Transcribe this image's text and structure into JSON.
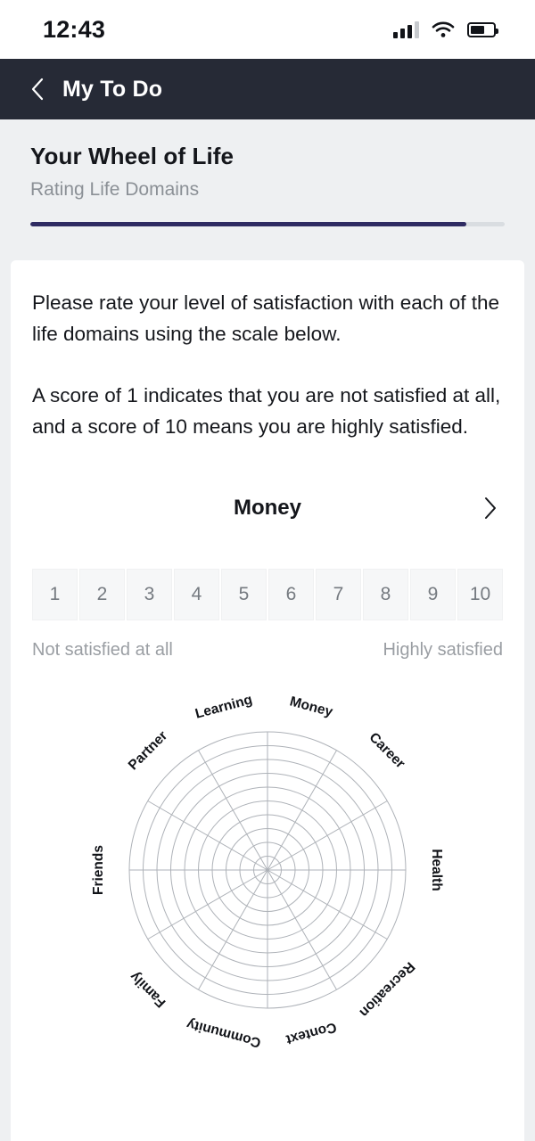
{
  "status_bar": {
    "time": "12:43",
    "signal_icon": "signal-bars-icon",
    "wifi_icon": "wifi-icon",
    "battery_icon": "battery-icon",
    "battery_level_pct": 62
  },
  "nav": {
    "back_icon": "chevron-left-icon",
    "title": "My To Do"
  },
  "header": {
    "title": "Your Wheel of Life",
    "subtitle": "Rating Life Domains",
    "progress_pct": 92
  },
  "content": {
    "paragraph_1": "Please rate your level of satisfaction with each of the life domains using the scale below.",
    "paragraph_2": "A score of 1 indicates that you are not satisfied at all, and a score of 10 means you are highly satisfied."
  },
  "domain_selector": {
    "current": "Money",
    "next_icon": "chevron-right-icon"
  },
  "scale": {
    "options": [
      "1",
      "2",
      "3",
      "4",
      "5",
      "6",
      "7",
      "8",
      "9",
      "10"
    ],
    "selected": null,
    "low_label": "Not satisfied at all",
    "high_label": "Highly satisfied"
  },
  "chart_data": {
    "type": "radar",
    "title": "Wheel of Life",
    "categories": [
      "Money",
      "Career",
      "Health",
      "Recreation",
      "Context",
      "Community",
      "Family",
      "Friends",
      "Partner",
      "Learning"
    ],
    "values": [
      0,
      0,
      0,
      0,
      0,
      0,
      0,
      0,
      0,
      0
    ],
    "rings": 10,
    "spokes": 12,
    "scale_min": 1,
    "scale_max": 10,
    "grid": true,
    "legend": "none",
    "grid_color": "#aeb2b8",
    "label_angles_deg": [
      15,
      45,
      90,
      135,
      165,
      195,
      225,
      270,
      315,
      345
    ]
  },
  "colors": {
    "accent": "#2e2b62",
    "navbar_bg": "#262a36",
    "page_bg": "#eef0f2",
    "card_bg": "#ffffff",
    "muted_text": "#8b9096"
  }
}
